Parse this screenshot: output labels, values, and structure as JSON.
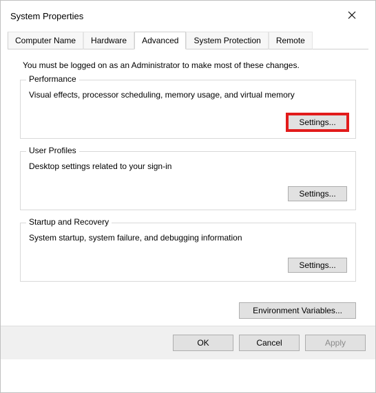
{
  "window": {
    "title": "System Properties"
  },
  "tabs": [
    {
      "label": "Computer Name"
    },
    {
      "label": "Hardware"
    },
    {
      "label": "Advanced"
    },
    {
      "label": "System Protection"
    },
    {
      "label": "Remote"
    }
  ],
  "adminNote": "You must be logged on as an Administrator to make most of these changes.",
  "groups": {
    "performance": {
      "title": "Performance",
      "desc": "Visual effects, processor scheduling, memory usage, and virtual memory",
      "button": "Settings..."
    },
    "userProfiles": {
      "title": "User Profiles",
      "desc": "Desktop settings related to your sign-in",
      "button": "Settings..."
    },
    "startupRecovery": {
      "title": "Startup and Recovery",
      "desc": "System startup, system failure, and debugging information",
      "button": "Settings..."
    }
  },
  "envButton": "Environment Variables...",
  "footer": {
    "ok": "OK",
    "cancel": "Cancel",
    "apply": "Apply"
  }
}
